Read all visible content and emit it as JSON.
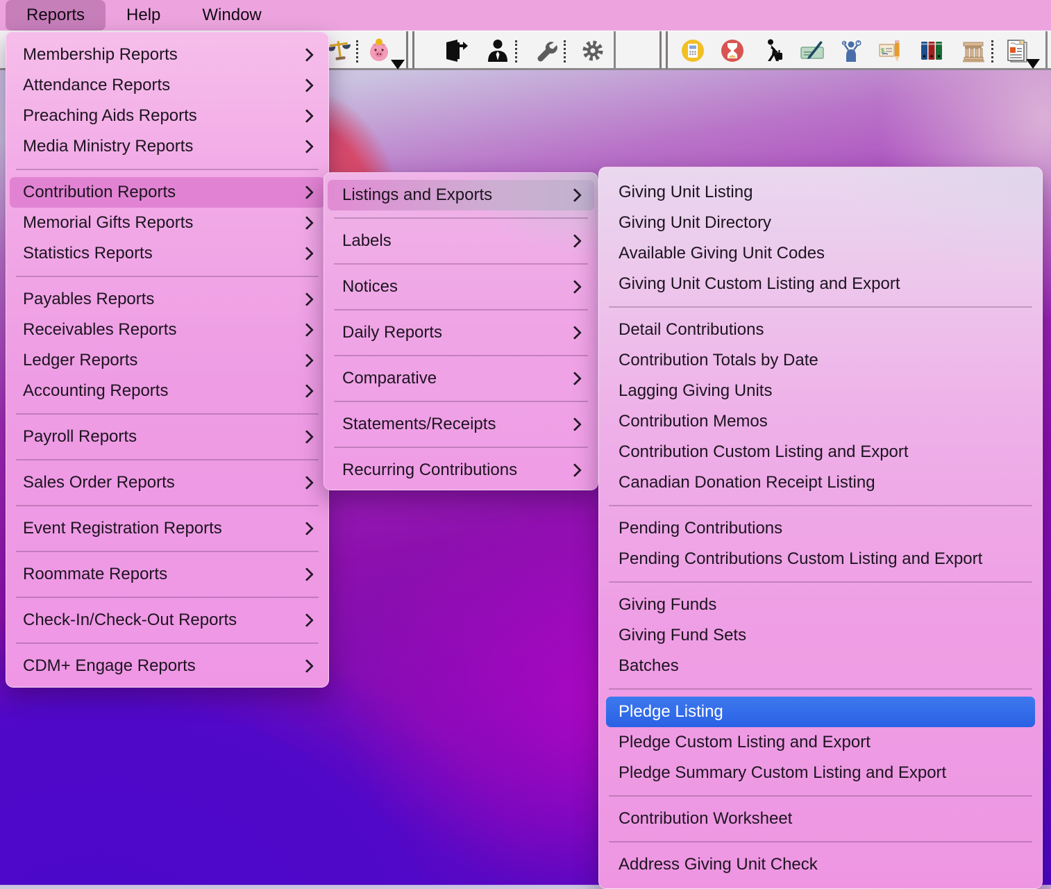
{
  "menubar": {
    "items": [
      "Reports",
      "Help",
      "Window"
    ],
    "active": "Reports"
  },
  "toolbar": {
    "icons": [
      "scales",
      "piggy-bank",
      "exit-door",
      "user",
      "wrench",
      "gear",
      "calculator",
      "hourglass",
      "traveler",
      "check-writing",
      "money-manager",
      "check-pencil",
      "binders",
      "bank",
      "report-document"
    ]
  },
  "reports_menu": {
    "highlighted": "Contribution Reports",
    "groups": [
      [
        "Membership Reports",
        "Attendance Reports",
        "Preaching Aids Reports",
        "Media Ministry Reports"
      ],
      [
        "Contribution Reports",
        "Memorial Gifts Reports",
        "Statistics Reports"
      ],
      [
        "Payables Reports",
        "Receivables Reports",
        "Ledger Reports",
        "Accounting Reports"
      ],
      [
        "Payroll Reports"
      ],
      [
        "Sales Order Reports"
      ],
      [
        "Event Registration Reports"
      ],
      [
        "Roommate Reports"
      ],
      [
        "Check-In/Check-Out Reports"
      ],
      [
        "CDM+ Engage Reports"
      ]
    ]
  },
  "contribution_reports_menu": {
    "highlighted": "Listings and Exports",
    "groups": [
      [
        "Listings and Exports"
      ],
      [
        "Labels"
      ],
      [
        "Notices"
      ],
      [
        "Daily Reports"
      ],
      [
        "Comparative"
      ],
      [
        "Statements/Receipts"
      ],
      [
        "Recurring Contributions"
      ]
    ]
  },
  "listings_and_exports_menu": {
    "highlighted": "Pledge Listing",
    "groups": [
      [
        "Giving Unit Listing",
        "Giving Unit Directory",
        "Available Giving Unit Codes",
        "Giving Unit Custom Listing and Export"
      ],
      [
        "Detail Contributions",
        "Contribution Totals by Date",
        "Lagging Giving Units",
        "Contribution Memos",
        "Contribution Custom Listing and Export",
        "Canadian Donation Receipt Listing"
      ],
      [
        "Pending Contributions",
        "Pending Contributions Custom Listing and Export"
      ],
      [
        "Giving Funds",
        "Giving Fund Sets",
        "Batches"
      ],
      [
        "Pledge Listing",
        "Pledge Custom Listing and Export",
        "Pledge Summary Custom Listing and Export"
      ],
      [
        "Contribution Worksheet"
      ],
      [
        "Address Giving Unit Check"
      ]
    ]
  },
  "colors": {
    "selection_blue": "#2d68e9",
    "menu_highlight_pink": "#e183d2",
    "menubar_pink": "#eda4de",
    "menubar_highlight": "#c77fba",
    "toolbar_background": "#f4f3f4",
    "menu_pink": "#ef9fe5"
  }
}
